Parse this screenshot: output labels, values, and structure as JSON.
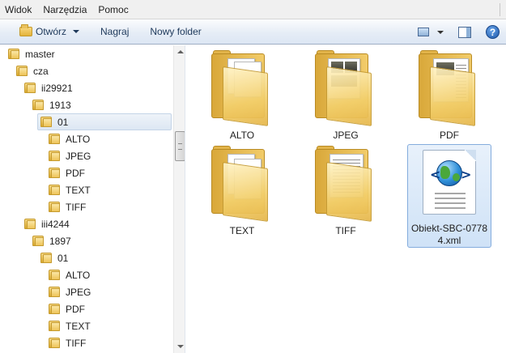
{
  "menubar": {
    "items": [
      {
        "label": "Widok"
      },
      {
        "label": "Narzędzia"
      },
      {
        "label": "Pomoc"
      }
    ]
  },
  "toolbar": {
    "open_label": "Otwórz",
    "burn_label": "Nagraj",
    "new_folder_label": "Nowy folder",
    "help_glyph": "?"
  },
  "tree": {
    "items": [
      {
        "label": "master",
        "level": 0
      },
      {
        "label": "cza",
        "level": 1
      },
      {
        "label": "ii29921",
        "level": 2
      },
      {
        "label": "1913",
        "level": 3
      },
      {
        "label": "01",
        "level": 4,
        "selected": true
      },
      {
        "label": "ALTO",
        "level": 5
      },
      {
        "label": "JPEG",
        "level": 5
      },
      {
        "label": "PDF",
        "level": 5
      },
      {
        "label": "TEXT",
        "level": 5
      },
      {
        "label": "TIFF",
        "level": 5
      },
      {
        "label": "iii4244",
        "level": 2
      },
      {
        "label": "1897",
        "level": 3
      },
      {
        "label": "01",
        "level": 4
      },
      {
        "label": "ALTO",
        "level": 5
      },
      {
        "label": "JPEG",
        "level": 5
      },
      {
        "label": "PDF",
        "level": 5
      },
      {
        "label": "TEXT",
        "level": 5
      },
      {
        "label": "TIFF",
        "level": 5
      }
    ]
  },
  "content": {
    "items": [
      {
        "label": "ALTO",
        "kind": "folder"
      },
      {
        "label": "JPEG",
        "kind": "folder"
      },
      {
        "label": "PDF",
        "kind": "folder"
      },
      {
        "label": "TEXT",
        "kind": "folder"
      },
      {
        "label": "TIFF",
        "kind": "folder"
      },
      {
        "label_line1": "Obiekt-SBC-0778",
        "label_line2": "4.xml",
        "kind": "xml-file",
        "selected": true
      }
    ]
  }
}
